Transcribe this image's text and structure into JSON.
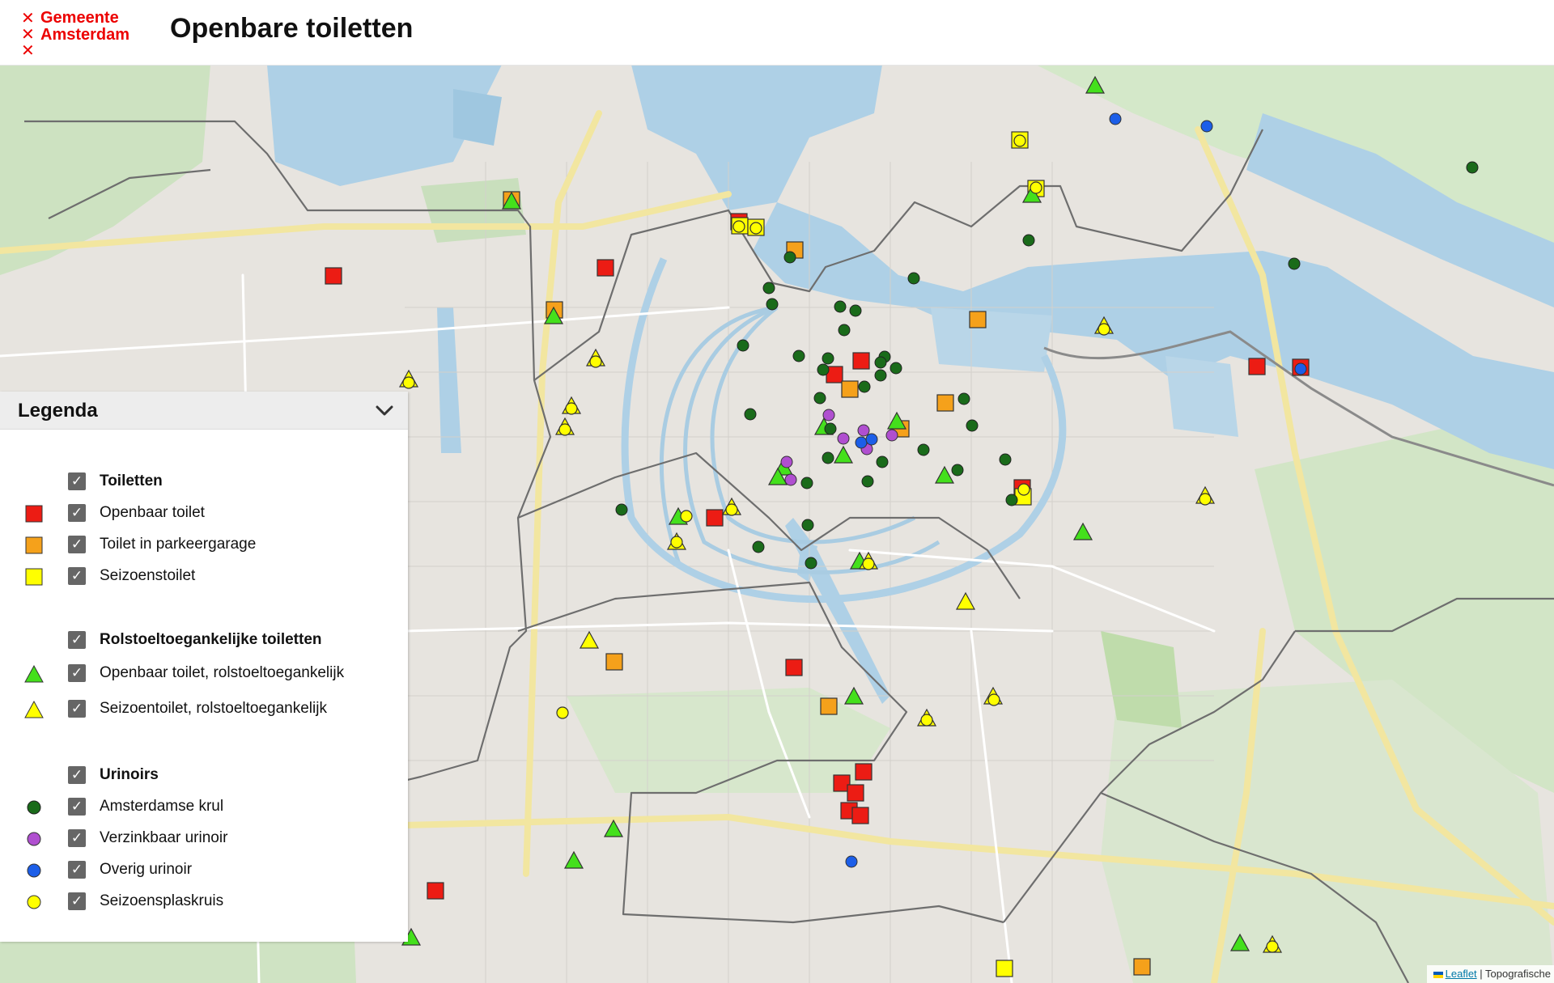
{
  "header": {
    "logo_line1": "Gemeente",
    "logo_line2": "Amsterdam",
    "title": "Openbare toiletten"
  },
  "legend": {
    "title": "Legenda",
    "groups": [
      {
        "label": "Toiletten",
        "checked": true,
        "items": [
          {
            "label": "Openbaar toilet",
            "symbol": "square",
            "color": "#ec1c14",
            "checked": true
          },
          {
            "label": "Toilet in parkeergarage",
            "symbol": "square",
            "color": "#f5a11b",
            "checked": true
          },
          {
            "label": "Seizoenstoilet",
            "symbol": "square",
            "color": "#ffff00",
            "checked": true
          }
        ]
      },
      {
        "label": "Rolstoeltoegankelijke toiletten",
        "checked": true,
        "items": [
          {
            "label": "Openbaar toilet, rolstoeltoegankelijk",
            "symbol": "triangle",
            "color": "#44e01c",
            "checked": true
          },
          {
            "label": "Seizoentoilet, rolstoeltoegankelijk",
            "symbol": "triangle",
            "color": "#ffff00",
            "checked": true
          }
        ]
      },
      {
        "label": "Urinoirs",
        "checked": true,
        "items": [
          {
            "label": "Amsterdamse krul",
            "symbol": "circle",
            "color": "#1a6b1a",
            "checked": true
          },
          {
            "label": "Verzinkbaar urinoir",
            "symbol": "circle",
            "color": "#b04fd0",
            "checked": true
          },
          {
            "label": "Overig urinoir",
            "symbol": "circle",
            "color": "#1c5ee8",
            "checked": true
          },
          {
            "label": "Seizoensplaskruis",
            "symbol": "circle",
            "color": "#ffff00",
            "checked": true
          }
        ]
      }
    ]
  },
  "attribution": {
    "leaflet": "Leaflet",
    "source": "| Topografische"
  }
}
